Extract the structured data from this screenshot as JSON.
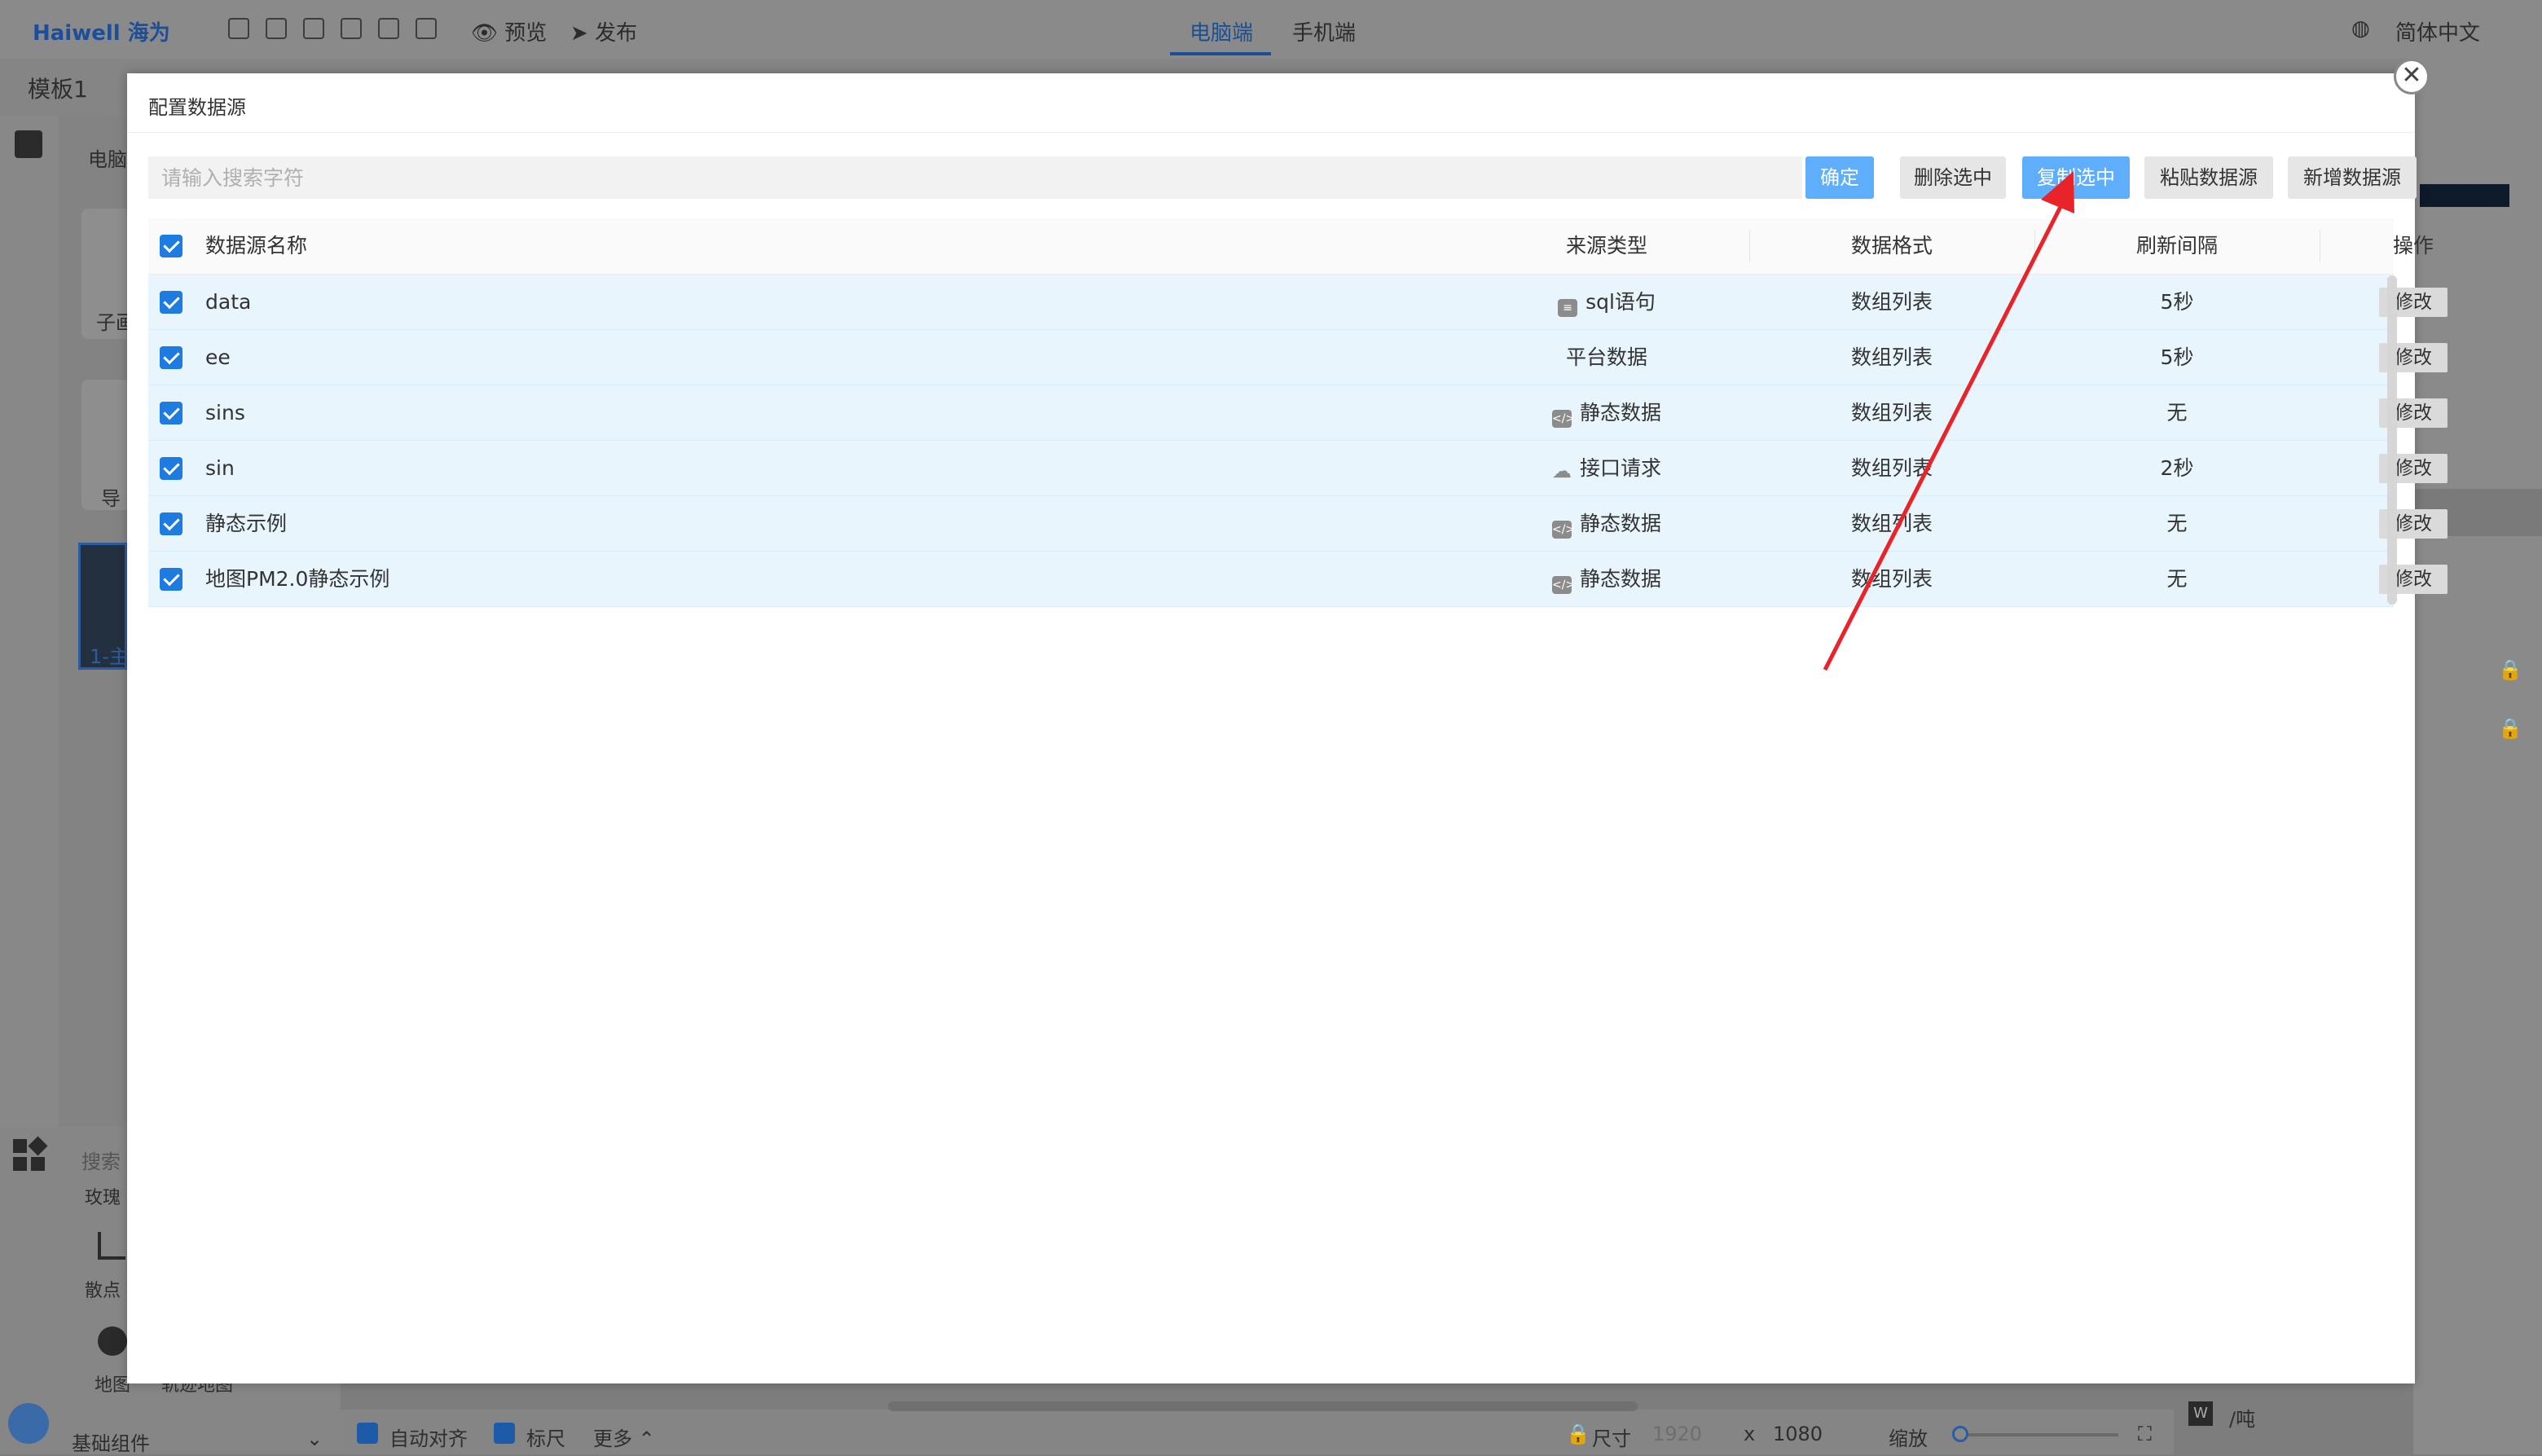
{
  "app": {
    "logo": "Haiwell 海为",
    "toolbar": {
      "preview": "预览",
      "publish": "发布"
    },
    "tabs": [
      "电脑端",
      "手机端"
    ],
    "language": "简体中文",
    "doc_title": "模板1",
    "left_tab": "电脑",
    "page_labels": [
      "子画",
      "导"
    ],
    "thumb_label": "1-主",
    "search_label": "搜索",
    "partial_label": "玫瑰",
    "component_labels": [
      "散点",
      "地图",
      "轨迹地图"
    ],
    "base_components": "基础组件",
    "bottom": {
      "auto_align": "自动对齐",
      "ruler": "标尺",
      "more": "更多",
      "size_label": "尺寸",
      "width": "1920",
      "x": "x",
      "height": "1080",
      "zoom_label": "缩放"
    },
    "right_unit": "/吨"
  },
  "modal": {
    "title": "配置数据源",
    "search_placeholder": "请输入搜索字符",
    "buttons": {
      "confirm": "确定",
      "delete_selected": "删除选中",
      "copy_selected": "复制选中",
      "paste": "粘贴数据源",
      "add": "新增数据源"
    },
    "columns": [
      "数据源名称",
      "来源类型",
      "数据格式",
      "刷新间隔",
      "操作"
    ],
    "rows": [
      {
        "name": "data",
        "source": "sql语句",
        "source_icon": "database-icon",
        "format": "数组列表",
        "interval": "5秒",
        "action": "修改"
      },
      {
        "name": "ee",
        "source": "平台数据",
        "source_icon": "",
        "format": "数组列表",
        "interval": "5秒",
        "action": "修改"
      },
      {
        "name": "sins",
        "source": "静态数据",
        "source_icon": "code-icon",
        "format": "数组列表",
        "interval": "无",
        "action": "修改"
      },
      {
        "name": "sin",
        "source": "接口请求",
        "source_icon": "cloud-icon",
        "format": "数组列表",
        "interval": "2秒",
        "action": "修改"
      },
      {
        "name": "静态示例",
        "source": "静态数据",
        "source_icon": "code-icon",
        "format": "数组列表",
        "interval": "无",
        "action": "修改"
      },
      {
        "name": "地图PM2.0静态示例",
        "source": "静态数据",
        "source_icon": "code-icon",
        "format": "数组列表",
        "interval": "无",
        "action": "修改"
      }
    ]
  },
  "colors": {
    "accent": "#1e7be0",
    "button_blue": "#5eaefc",
    "row_selected": "#e8f5fd",
    "annotation_arrow": "#e8232a"
  }
}
